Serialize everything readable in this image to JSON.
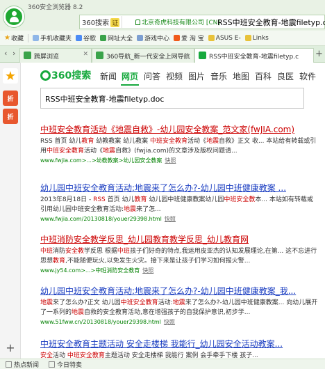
{
  "window": {
    "title": "360安全浏览器 8.2"
  },
  "address": {
    "mode_label": "360搜索",
    "cert_badge": "证",
    "secure_site": "北京奇虎科技有限公司 [CN]",
    "url_text": "RSS中班安全教育-地震filetyp.doc"
  },
  "bookmarks": [
    {
      "label": "收藏",
      "icon": "star-icon"
    },
    {
      "label": "手机收藏夹",
      "icon": "phone-icon"
    },
    {
      "label": "谷歌",
      "icon": "google-icon"
    },
    {
      "label": "网址大全",
      "icon": "globe-icon"
    },
    {
      "label": "游戏中心",
      "icon": "game-icon"
    },
    {
      "label": "爱 淘 宝",
      "icon": "taobao-icon"
    },
    {
      "label": "ASUS E-",
      "icon": "asus-icon"
    },
    {
      "label": "Links",
      "icon": "folder-icon"
    }
  ],
  "tabs": [
    {
      "label": "跨屏浏览",
      "active": false
    },
    {
      "label": "360导航_新一代安全上网导航",
      "active": false
    },
    {
      "label": "RSS中班安全教育-地震filetyp.c",
      "active": true
    }
  ],
  "sidebar": {
    "zhe_label": "折",
    "zhe2_label": "折"
  },
  "search": {
    "logo_text": "360搜索",
    "nav": [
      "新闻",
      "网页",
      "问答",
      "视频",
      "图片",
      "音乐",
      "地图",
      "百科",
      "良医",
      "软件"
    ],
    "nav_active": "网页",
    "query": "RSS中班安全教育-地震filetyp.doc"
  },
  "results": [
    {
      "title": "中班安全教育活动《地震自救》-幼儿园安全教案_范文家(fwJIA.com)",
      "desc_parts": [
        {
          "t": "RSS",
          "hl": false
        },
        {
          "t": " 首页 幼儿",
          "hl": false
        },
        {
          "t": "教育",
          "hl": true
        },
        {
          "t": " 幼教教案 幼儿教案 ",
          "hl": false
        },
        {
          "t": "中班安全教育",
          "hl": true
        },
        {
          "t": "活动《",
          "hl": false
        },
        {
          "t": "地震",
          "hl": true
        },
        {
          "t": "自救》正文 收... 本站给有转载或引用",
          "hl": false
        },
        {
          "t": "中班安全教育",
          "hl": true
        },
        {
          "t": "活动《",
          "hl": false
        },
        {
          "t": "地震",
          "hl": true
        },
        {
          "t": "自救》(fwjia.com)的文章涉及版权问题请...",
          "hl": false
        }
      ],
      "url": "www.fwjia.com>...>幼教教案>幼儿园安全教案",
      "snapshot": "快照"
    },
    {
      "title": "幼儿园中班安全教育活动:地震来了怎么办?-幼儿园中班健康教案 ...",
      "desc_parts": [
        {
          "t": "2013年8月18日 - ",
          "hl": false
        },
        {
          "t": "RSS",
          "hl": true
        },
        {
          "t": " 首页 幼儿",
          "hl": false
        },
        {
          "t": "教育",
          "hl": true
        },
        {
          "t": " 幼儿园中班健康教案幼儿园",
          "hl": false
        },
        {
          "t": "中班安全教",
          "hl": true
        },
        {
          "t": "本... 本站如有转载或引用幼儿园中班安全教育活动:",
          "hl": false
        },
        {
          "t": "地震",
          "hl": true
        },
        {
          "t": "来了怎...",
          "hl": false
        }
      ],
      "url": "www.fwjia.com/20130818/youer29398.html",
      "snapshot": "快照"
    },
    {
      "title": "中班消防安全教学反思_幼儿园教育教学反思_幼儿教育网",
      "desc_parts": [
        {
          "t": "中班",
          "hl": true
        },
        {
          "t": "消防",
          "hl": false
        },
        {
          "t": "安全教",
          "hl": true
        },
        {
          "t": "学反思 根据",
          "hl": false
        },
        {
          "t": "中班",
          "hl": true
        },
        {
          "t": "孩子们好奇的特点,我运用皮亚杰的认知发展理论,在第... 这不忘进行思想",
          "hl": false
        },
        {
          "t": "教育",
          "hl": true
        },
        {
          "t": ",不能随便玩火,以免发生火灾。接下来是让孩子们学习如何报火警...",
          "hl": false
        }
      ],
      "url": "www.jy54.com>...>中班消防安全教育",
      "snapshot": "快照"
    },
    {
      "title": "幼儿园中班安全教育活动:地震来了怎么办?-幼儿园中班健康教案_我...",
      "desc_parts": [
        {
          "t": "地震",
          "hl": true
        },
        {
          "t": "来了怎么办?正文 幼儿园",
          "hl": false
        },
        {
          "t": "中班安全教育",
          "hl": true
        },
        {
          "t": "活动:",
          "hl": false
        },
        {
          "t": "地震",
          "hl": true
        },
        {
          "t": "来了怎么办?-幼儿园中班健康教案... 向幼儿展开了一系列的",
          "hl": false
        },
        {
          "t": "地震",
          "hl": true
        },
        {
          "t": "自救的安全教育活动,意在增强孩子的自我保护意识,初步学...",
          "hl": false
        }
      ],
      "url": "www.51fww.cn/20130818/youer29398.html",
      "snapshot": "快照"
    },
    {
      "title": "中班安全教育主题活动 安全走楼梯 我能行_幼儿园安全活动教案...",
      "desc_parts": [
        {
          "t": "安全",
          "hl": true
        },
        {
          "t": "活动 ",
          "hl": false
        },
        {
          "t": "中班安全教育",
          "hl": true
        },
        {
          "t": "主题活动 安全走楼梯 我能行 案例 会手牵手下楼 孩子...",
          "hl": false
        }
      ],
      "url": "",
      "snapshot": ""
    }
  ],
  "statusbar": {
    "hot_news": "热点新闻",
    "today_special": "今日特卖"
  }
}
